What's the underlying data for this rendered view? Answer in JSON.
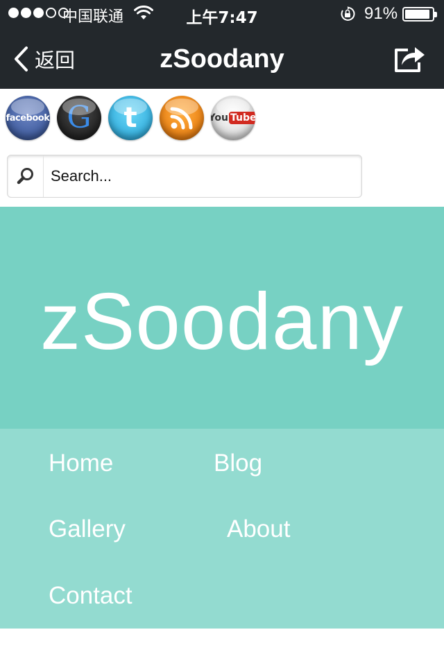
{
  "status_bar": {
    "carrier": "中国联通",
    "time": "上午7:47",
    "battery_percent": "91%",
    "battery_level": 0.91,
    "signal_bars_filled": 3,
    "signal_bars_total": 5
  },
  "nav_bar": {
    "back_label": "返回",
    "title": "zSoodany",
    "share_icon": "share-icon",
    "background": "#23282c"
  },
  "social_icons": [
    {
      "name": "facebook",
      "label": "facebook"
    },
    {
      "name": "google",
      "label": "G"
    },
    {
      "name": "twitter",
      "label": "t"
    },
    {
      "name": "rss",
      "label": ""
    },
    {
      "name": "youtube",
      "label_you": "You",
      "label_tube": "Tube"
    }
  ],
  "search": {
    "placeholder": "Search...",
    "value": ""
  },
  "hero": {
    "title": "zSoodany",
    "background": "#77d1c3"
  },
  "menu": {
    "background": "#93dbd0",
    "items": [
      {
        "label": "Home"
      },
      {
        "label": "Blog"
      },
      {
        "label": "Gallery"
      },
      {
        "label": "About"
      },
      {
        "label": "Contact"
      }
    ]
  }
}
